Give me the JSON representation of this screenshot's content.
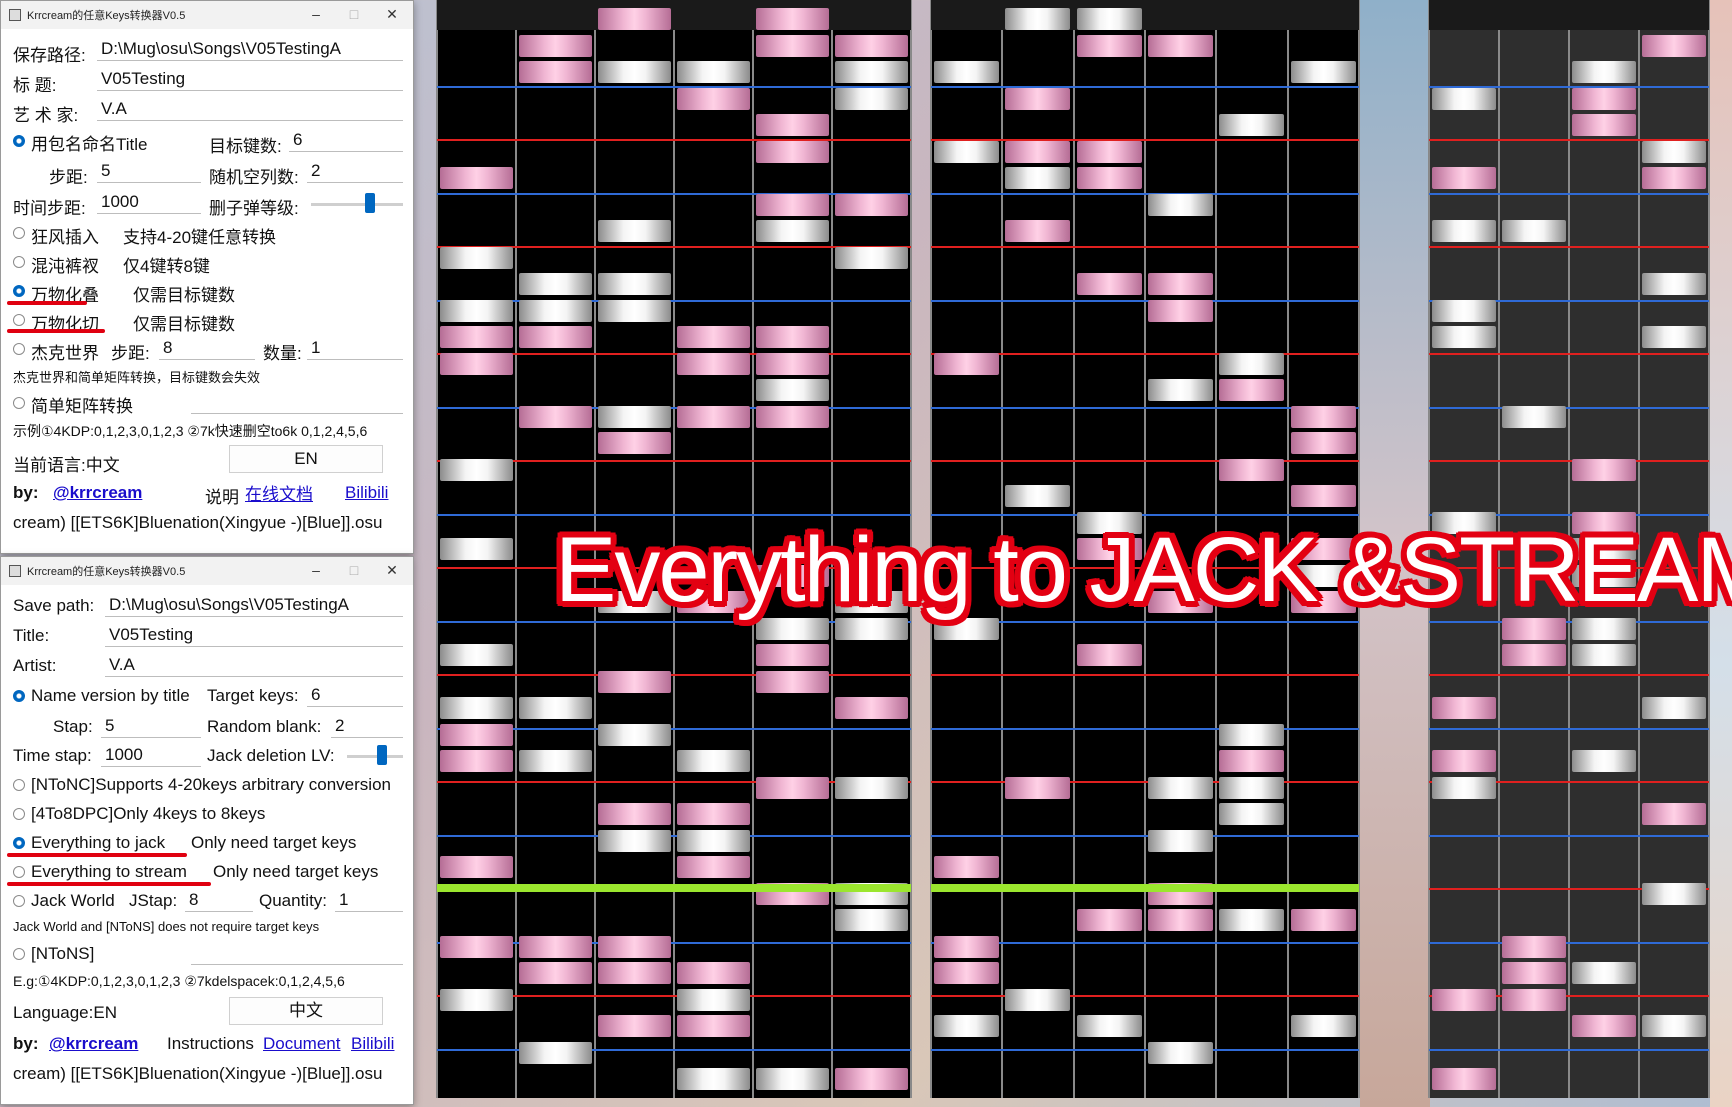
{
  "colors": {
    "red_line": "#e0201f",
    "blue_line": "#2f6ad6",
    "judgement_line": "#9be62e",
    "note_white": "#f4f4f4",
    "note_pink": "#f0b6d3",
    "headline_stroke": "#e30012",
    "radio_selected": "#0067c0"
  },
  "headline": "Everything to JACK &STREAM",
  "window_cn": {
    "title": "Krrcream的任意Keys转换器V0.5",
    "save_path_label": "保存路径:",
    "save_path_value": "D:\\Mug\\osu\\Songs\\V05TestingA",
    "title_label": "标    题:",
    "title_value": "V05Testing",
    "artist_label": "艺 术 家:",
    "artist_value": "V.A",
    "name_by_title": "用包名命名Title",
    "target_keys_label": "目标键数:",
    "target_keys_value": "6",
    "step_label": "步距:",
    "step_value": "5",
    "random_blank_label": "随机空列数:",
    "random_blank_value": "2",
    "time_step_label": "时间步距:",
    "time_step_value": "1000",
    "jack_delete_label": "删子弹等级:",
    "mode1": "狂风插入",
    "mode1_desc": "支持4-20键任意转换",
    "mode2": "混沌裤衩",
    "mode2_desc": "仅4键转8键",
    "mode3": "万物化叠",
    "mode3_desc": "仅需目标键数",
    "mode4": "万物化切",
    "mode4_desc": "仅需目标键数",
    "jack_world": "杰克世界",
    "jw_step_label": "步距:",
    "jw_step_value": "8",
    "quantity_label": "数量:",
    "quantity_value": "1",
    "note": "杰克世界和简单矩阵转换，目标键数会失效",
    "matrix": "简单矩阵转换",
    "example": "示例①4KDP:0,1,2,3,0,1,2,3 ②7k快速删空to6k 0,1,2,4,5,6",
    "language": "当前语言:中文",
    "lang_button": "EN",
    "by_label": "by:",
    "author": "@krrcream",
    "instructions": "说明",
    "doc_link": "在线文档",
    "bilibili": "Bilibili",
    "file": "cream) [[ETS6K]Bluenation(Xingyue -)[Blue]].osu"
  },
  "window_en": {
    "title": "Krrcream的任意Keys转换器V0.5",
    "save_path_label": "Save path:",
    "save_path_value": "D:\\Mug\\osu\\Songs\\V05TestingA",
    "title_label": "Title:",
    "title_value": "V05Testing",
    "artist_label": "Artist:",
    "artist_value": "V.A",
    "name_by_title": "Name version by title",
    "target_keys_label": "Target keys:",
    "target_keys_value": "6",
    "step_label": "Stap:",
    "step_value": "5",
    "random_blank_label": "Random blank:",
    "random_blank_value": "2",
    "time_step_label": "Time stap:",
    "time_step_value": "1000",
    "jack_delete_label": "Jack deletion LV:",
    "mode1": "[NToNC]Supports 4-20keys arbitrary conversion",
    "mode2": "[4To8DPC]Only 4keys to 8keys",
    "mode3": "Everything to jack",
    "mode3_desc": "Only need target keys",
    "mode4": "Everything to stream",
    "mode4_desc": "Only need target keys",
    "jack_world": "Jack World",
    "jw_step_label": "JStap:",
    "jw_step_value": "8",
    "quantity_label": "Quantity:",
    "quantity_value": "1",
    "note": "Jack World and [NToNS] does not require target keys",
    "matrix": "[NToNS]",
    "example": "E.g:①4KDP:0,1,2,3,0,1,2,3 ②7kdelspacek:0,1,2,4,5,6",
    "language": "Language:EN",
    "lang_button": "中文",
    "by_label": "by:",
    "author": "@krrcream",
    "instructions": "Instructions",
    "doc_link": "Document",
    "bilibili": "Bilibili",
    "file": "cream) [[ETS6K]Bluenation(Xingyue -)[Blue]].osu"
  }
}
